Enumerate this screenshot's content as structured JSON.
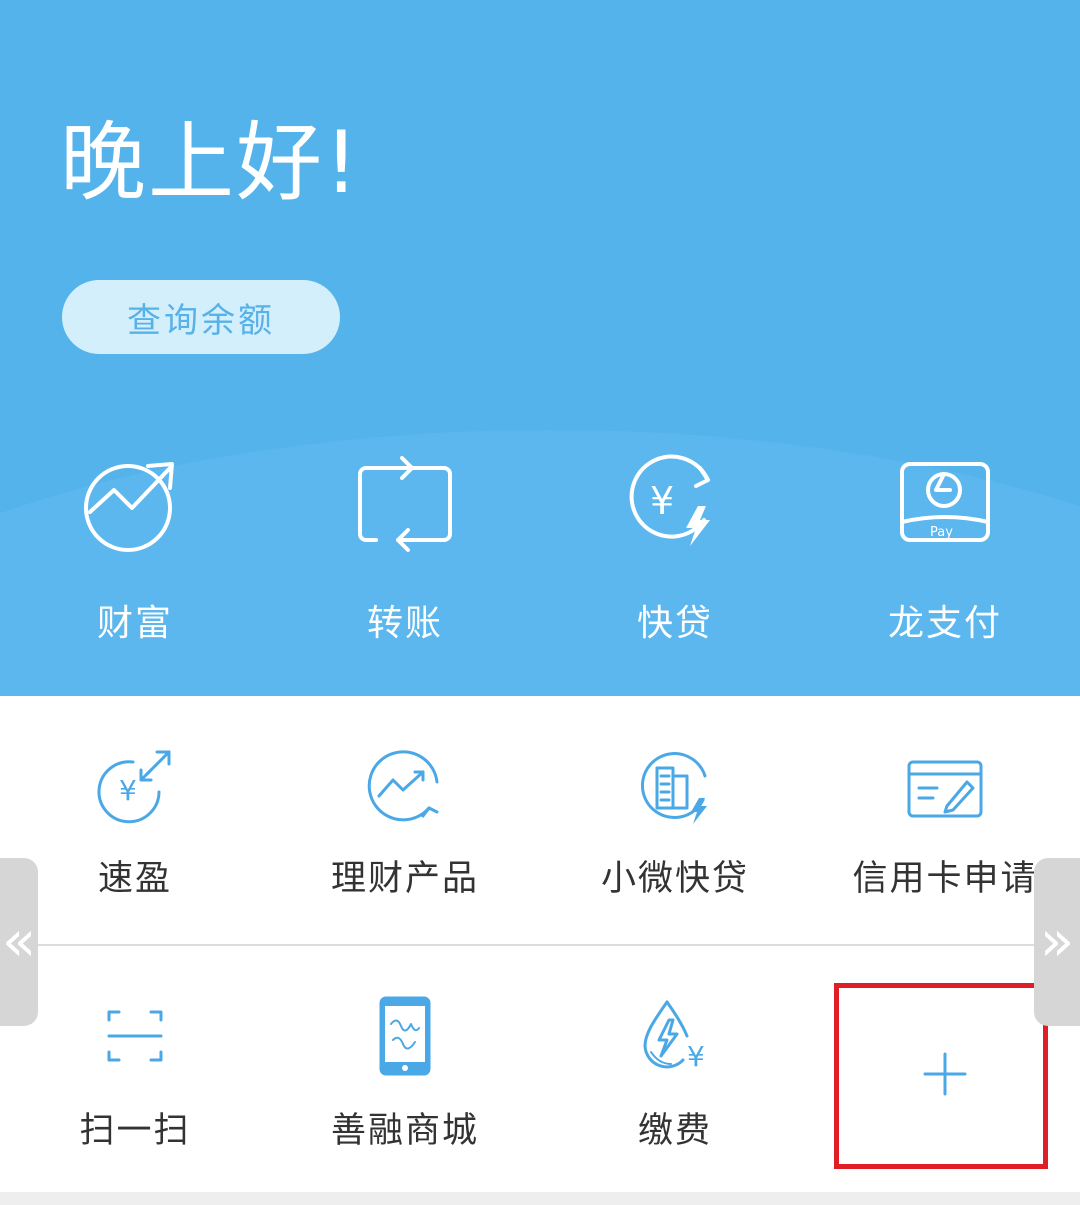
{
  "header": {
    "greeting": "晚上好!",
    "balance_button": "查询余额",
    "background_color": "#55b3ec",
    "items": [
      {
        "label": "财富",
        "icon": "wealth-growth-icon"
      },
      {
        "label": "转账",
        "icon": "transfer-icon"
      },
      {
        "label": "快贷",
        "icon": "quick-loan-icon"
      },
      {
        "label": "龙支付",
        "icon": "long-pay-icon"
      }
    ]
  },
  "shortcuts": {
    "row1": [
      {
        "label": "速盈",
        "icon": "yuan-exchange-icon"
      },
      {
        "label": "理财产品",
        "icon": "financial-product-icon"
      },
      {
        "label": "小微快贷",
        "icon": "small-business-loan-icon"
      },
      {
        "label": "信用卡申请",
        "icon": "credit-card-apply-icon"
      }
    ],
    "row2": [
      {
        "label": "扫一扫",
        "icon": "scan-icon"
      },
      {
        "label": "善融商城",
        "icon": "mall-phone-icon"
      },
      {
        "label": "缴费",
        "icon": "utility-payment-icon"
      },
      {
        "label": "",
        "icon": "plus-icon"
      }
    ]
  },
  "nav": {
    "prev_arrow": "«",
    "next_arrow": "»"
  },
  "colors": {
    "accent": "#4aa8e6",
    "highlight": "#e01e26"
  }
}
